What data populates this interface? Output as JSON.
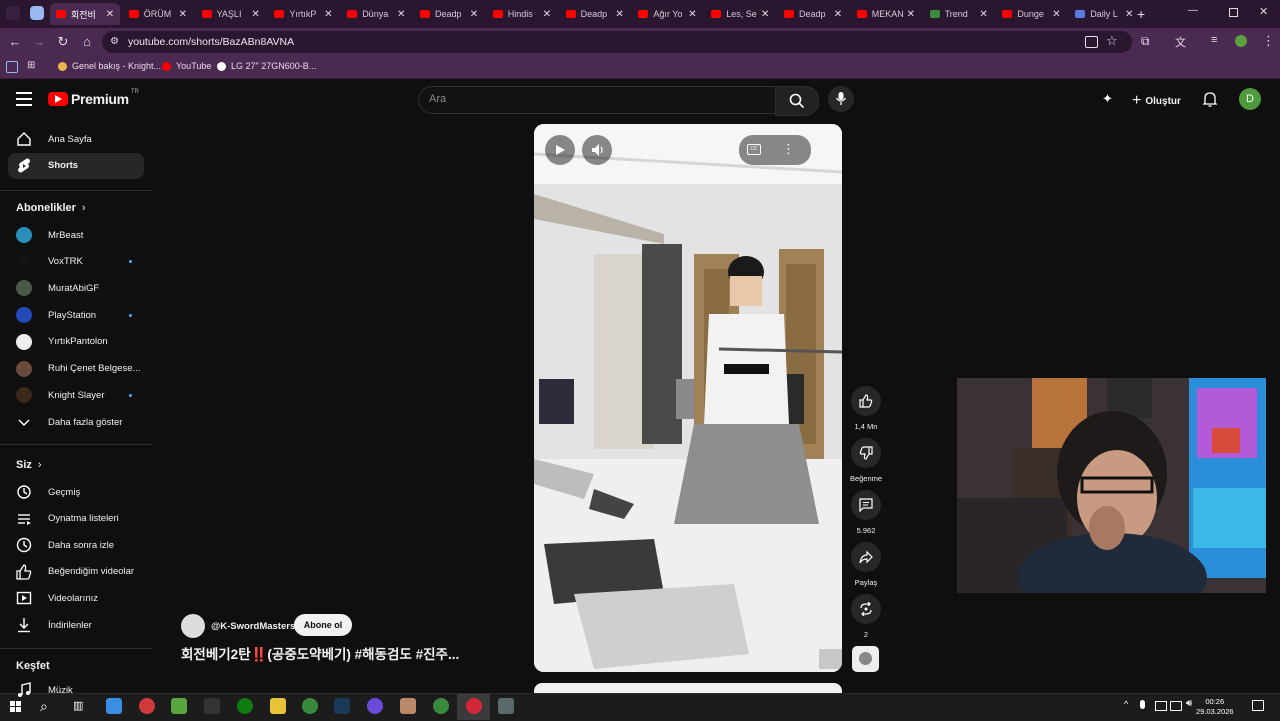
{
  "browser": {
    "tabs": [
      {
        "title": "회전비",
        "active": true
      },
      {
        "title": "ÖRÜM",
        "active": false
      },
      {
        "title": "YAŞLI",
        "active": false
      },
      {
        "title": "YırtıkP",
        "active": false
      },
      {
        "title": "Dünya",
        "active": false
      },
      {
        "title": "Deadp",
        "active": false
      },
      {
        "title": "Hindis",
        "active": false
      },
      {
        "title": "Deadp",
        "active": false
      },
      {
        "title": "Ağır Yo",
        "active": false
      },
      {
        "title": "Les, Se",
        "active": false
      },
      {
        "title": "Deadp",
        "active": false
      },
      {
        "title": "MEKAN",
        "active": false
      },
      {
        "title": "Trend",
        "active": false
      },
      {
        "title": "Dunge",
        "active": false
      },
      {
        "title": "Daily L",
        "active": false
      }
    ],
    "url": "youtube.com/shorts/BazABn8AVNA",
    "bookmarks": [
      {
        "label": "Genel bakış - Knight...",
        "color": "#e8b84a"
      },
      {
        "label": "YouTube",
        "color": "#ff0000"
      },
      {
        "label": "LG 27\" 27GN600-B...",
        "color": "#ffffff"
      }
    ]
  },
  "header": {
    "logo_text": "Premium",
    "logo_sup": "TR",
    "search_placeholder": "Ara",
    "create_label": "Oluştur",
    "avatar_letter": "D"
  },
  "sidebar": {
    "main": [
      {
        "label": "Ana Sayfa",
        "icon": "home-icon"
      },
      {
        "label": "Shorts",
        "icon": "shorts-icon",
        "selected": true
      }
    ],
    "subscriptions_title": "Abonelikler",
    "subscriptions": [
      {
        "label": "MrBeast",
        "color": "#2a8fb8",
        "dot": false
      },
      {
        "label": "VoxTRK",
        "color": "#111111",
        "dot": true
      },
      {
        "label": "MuratAbiGF",
        "color": "#4a5a4a",
        "dot": false
      },
      {
        "label": "PlayStation",
        "color": "#1f4ab8",
        "dot": true
      },
      {
        "label": "YırtıkPantolon",
        "color": "#eeeeee",
        "dot": false
      },
      {
        "label": "Ruhi Çenet Belgese...",
        "color": "#6a4a3a",
        "dot": false
      },
      {
        "label": "Knight Slayer",
        "color": "#3a2a1a",
        "dot": true
      }
    ],
    "show_more": "Daha fazla göster",
    "you_title": "Siz",
    "you_items": [
      {
        "label": "Geçmiş",
        "icon": "history-icon"
      },
      {
        "label": "Oynatma listeleri",
        "icon": "playlists-icon"
      },
      {
        "label": "Daha sonra izle",
        "icon": "clock-icon"
      },
      {
        "label": "Beğendiğim videolar",
        "icon": "thumbs-up-icon"
      },
      {
        "label": "Videolarınız",
        "icon": "your-videos-icon"
      },
      {
        "label": "İndirilenler",
        "icon": "download-icon"
      }
    ],
    "explore_title": "Keşfet",
    "explore_items": [
      {
        "label": "Müzik",
        "icon": "music-icon"
      }
    ]
  },
  "short": {
    "channel": "@K-SwordMasters",
    "subscribe_label": "Abone ol",
    "title": "회전베기2탄‼️(공중도약베기) #해동검도 #진주...",
    "actions": {
      "like_count": "1,4 Mn",
      "dislike_label": "Beğenme",
      "comment_count": "5.962",
      "share_label": "Paylaş",
      "remix_count": "2"
    }
  },
  "taskbar": {
    "time": "00:26",
    "date": "29.03.2026"
  }
}
